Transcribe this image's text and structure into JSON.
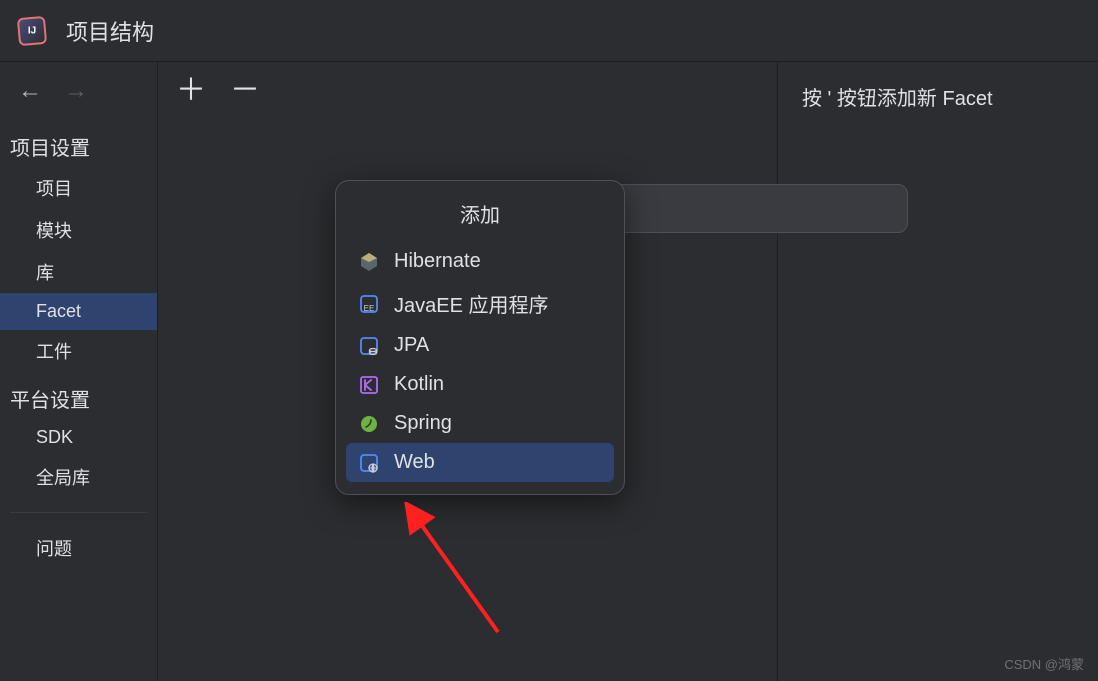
{
  "window": {
    "title": "项目结构"
  },
  "sidebar": {
    "section1_title": "项目设置",
    "section1_items": [
      {
        "label": "项目",
        "selected": false
      },
      {
        "label": "模块",
        "selected": false
      },
      {
        "label": "库",
        "selected": false
      },
      {
        "label": "Facet",
        "selected": true
      },
      {
        "label": "工件",
        "selected": false
      }
    ],
    "section2_title": "平台设置",
    "section2_items": [
      {
        "label": "SDK",
        "selected": false
      },
      {
        "label": "全局库",
        "selected": false
      }
    ],
    "section3_items": [
      {
        "label": "问题",
        "selected": false
      }
    ]
  },
  "popup": {
    "title": "添加",
    "items": [
      {
        "label": "Hibernate",
        "icon": "hibernate-icon"
      },
      {
        "label": "JavaEE 应用程序",
        "icon": "javaee-icon"
      },
      {
        "label": "JPA",
        "icon": "jpa-icon"
      },
      {
        "label": "Kotlin",
        "icon": "kotlin-icon"
      },
      {
        "label": "Spring",
        "icon": "spring-icon"
      },
      {
        "label": "Web",
        "icon": "web-icon",
        "selected": true
      }
    ]
  },
  "hint": {
    "text": "按 ' 按钮添加新 Facet"
  },
  "watermark": "CSDN @鸿蒙"
}
